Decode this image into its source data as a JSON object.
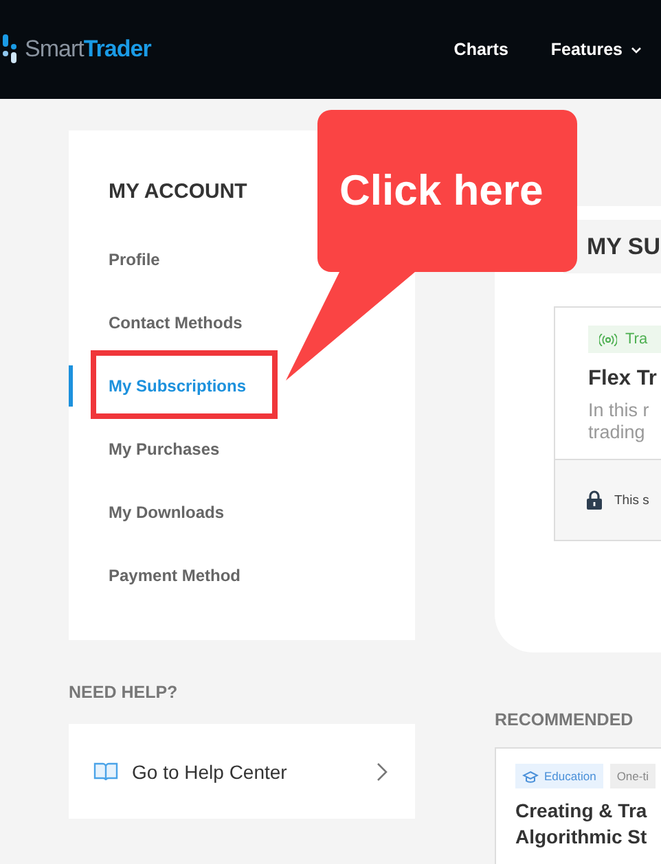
{
  "header": {
    "brand_light": "Smart",
    "brand_bold": "Trader",
    "nav": [
      {
        "label": "Charts",
        "dropdown": false
      },
      {
        "label": "Features",
        "dropdown": true
      }
    ]
  },
  "account_menu": {
    "title": "MY ACCOUNT",
    "items": [
      {
        "label": "Profile",
        "selected": false,
        "highlighted": false
      },
      {
        "label": "Contact Methods",
        "selected": false,
        "highlighted": false
      },
      {
        "label": "My Subscriptions",
        "selected": true,
        "highlighted": true
      },
      {
        "label": "My Purchases",
        "selected": false,
        "highlighted": false
      },
      {
        "label": "My Downloads",
        "selected": false,
        "highlighted": false
      },
      {
        "label": "Payment Method",
        "selected": false,
        "highlighted": false
      }
    ]
  },
  "help": {
    "title": "NEED HELP?",
    "link": "Go to Help Center"
  },
  "subscriptions": {
    "title": "MY SU",
    "card": {
      "tag": "Tra",
      "name": "Flex Tr",
      "description_lines": [
        "In this r",
        "trading"
      ],
      "footer": "This s"
    }
  },
  "recommended": {
    "title": "RECOMMENDED",
    "card": {
      "tags": [
        {
          "label": "Education",
          "kind": "category"
        },
        {
          "label": "One-ti",
          "kind": "type"
        }
      ],
      "title_lines": [
        "Creating & Tra",
        "Algorithmic St"
      ]
    }
  },
  "annotation": {
    "text": "Click here"
  }
}
